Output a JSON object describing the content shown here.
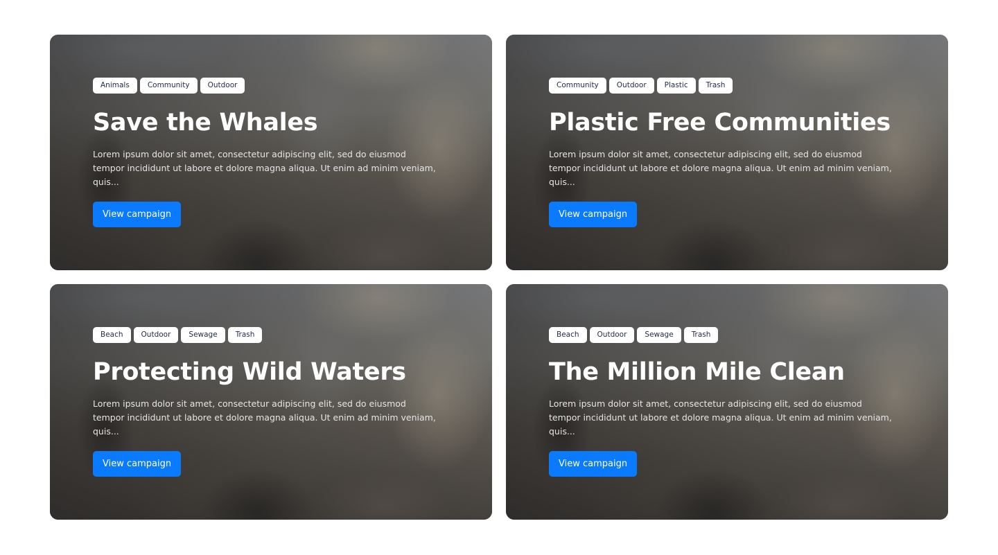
{
  "campaigns": [
    {
      "tags": [
        "Animals",
        "Community",
        "Outdoor"
      ],
      "title": "Save the Whales",
      "description": "Lorem ipsum dolor sit amet, consectetur adipiscing elit, sed do eiusmod tempor incididunt ut labore et dolore magna aliqua. Ut enim ad minim veniam, quis...",
      "button_label": "View campaign"
    },
    {
      "tags": [
        "Community",
        "Outdoor",
        "Plastic",
        "Trash"
      ],
      "title": "Plastic Free Communities",
      "description": "Lorem ipsum dolor sit amet, consectetur adipiscing elit, sed do eiusmod tempor incididunt ut labore et dolore magna aliqua. Ut enim ad minim veniam, quis...",
      "button_label": "View campaign"
    },
    {
      "tags": [
        "Beach",
        "Outdoor",
        "Sewage",
        "Trash"
      ],
      "title": "Protecting Wild Waters",
      "description": "Lorem ipsum dolor sit amet, consectetur adipiscing elit, sed do eiusmod tempor incididunt ut labore et dolore magna aliqua. Ut enim ad minim veniam, quis...",
      "button_label": "View campaign"
    },
    {
      "tags": [
        "Beach",
        "Outdoor",
        "Sewage",
        "Trash"
      ],
      "title": "The Million Mile Clean",
      "description": "Lorem ipsum dolor sit amet, consectetur adipiscing elit, sed do eiusmod tempor incididunt ut labore et dolore magna aliqua. Ut enim ad minim veniam, quis...",
      "button_label": "View campaign"
    }
  ],
  "colors": {
    "button": "#0a7bff",
    "tag_background": "#ffffff",
    "tag_text": "#1f2a4a",
    "title": "#ffffff"
  },
  "icons": {
    "card_background": "beach-cleanup-photo"
  }
}
